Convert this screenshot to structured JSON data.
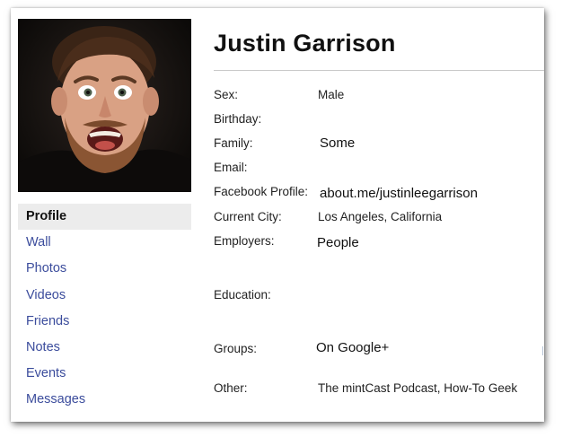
{
  "profile": {
    "name": "Justin Garrison",
    "photo_alt": "profile-photo"
  },
  "nav": {
    "items": [
      {
        "label": "Profile",
        "active": true
      },
      {
        "label": "Wall"
      },
      {
        "label": "Photos"
      },
      {
        "label": "Videos"
      },
      {
        "label": "Friends"
      },
      {
        "label": "Notes"
      },
      {
        "label": "Events"
      },
      {
        "label": "Messages"
      }
    ]
  },
  "info": {
    "sex": {
      "label": "Sex:",
      "value": "Male"
    },
    "birthday": {
      "label": "Birthday:",
      "value": ""
    },
    "family": {
      "label": "Family:",
      "value": "Some"
    },
    "email": {
      "label": "Email:",
      "value": ""
    },
    "facebook": {
      "label": "Facebook Profile:",
      "value": "about.me/justinleegarrison"
    },
    "city": {
      "label": "Current City:",
      "value": "Los Angeles, California"
    },
    "employers": {
      "label": "Employers:",
      "value": "People"
    },
    "education": {
      "label": "Education:",
      "value": ""
    },
    "groups": {
      "label": "Groups:",
      "value": "On Google+"
    },
    "other": {
      "label": "Other:",
      "value": "The mintCast Podcast, How-To Geek"
    }
  },
  "colors": {
    "link": "#3b4c9c",
    "active_bg": "#ececec",
    "text": "#222222",
    "divider": "#c9c9c9"
  }
}
